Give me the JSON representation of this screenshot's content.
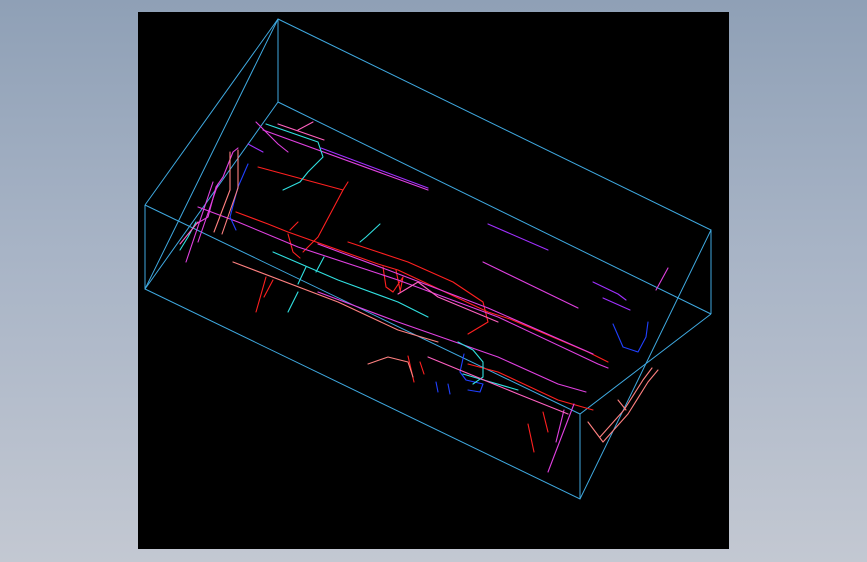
{
  "viewport": {
    "background": "#000000",
    "page_background": "#9aa8bc"
  },
  "colors": {
    "bounding_box": "#3fa9e0",
    "red": "#ff2020",
    "magenta": "#e040e0",
    "violet": "#a030ff",
    "blue": "#2040ff",
    "cyan": "#30e0e0",
    "salmon": "#ff8080",
    "pink": "#ff60c0"
  },
  "groups": [
    {
      "name": "bounding-box",
      "color_key": "bounding_box"
    },
    {
      "name": "red-piping",
      "color_key": "red"
    },
    {
      "name": "magenta-piping",
      "color_key": "magenta"
    },
    {
      "name": "violet-piping",
      "color_key": "violet"
    },
    {
      "name": "blue-piping",
      "color_key": "blue"
    },
    {
      "name": "cyan-piping",
      "color_key": "cyan"
    },
    {
      "name": "salmon-piping",
      "color_key": "salmon"
    },
    {
      "name": "pink-piping",
      "color_key": "pink"
    }
  ]
}
